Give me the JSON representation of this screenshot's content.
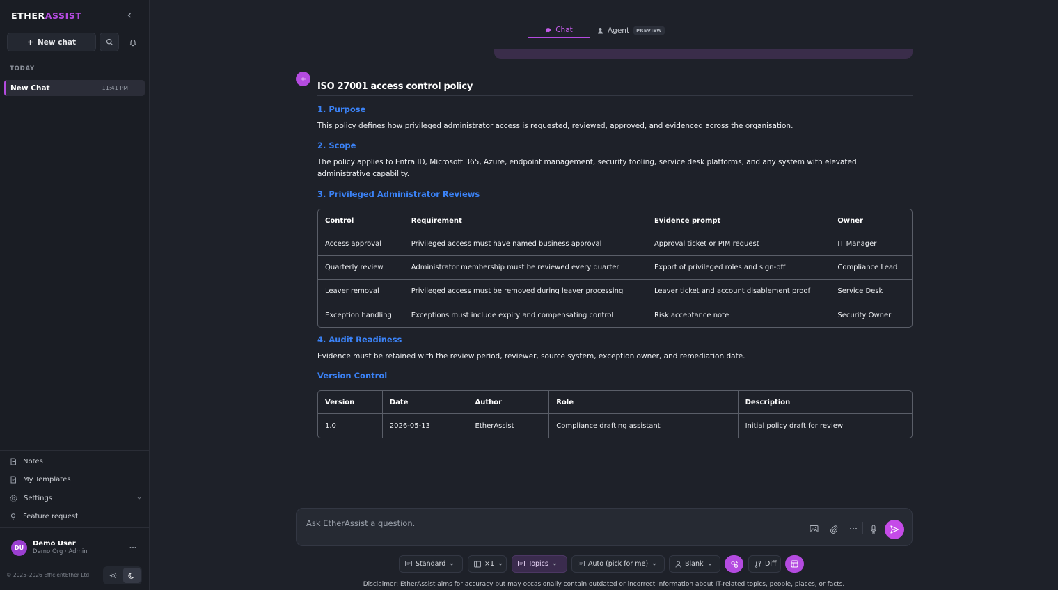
{
  "app": {
    "logo_part1": "ETHER",
    "logo_part2": "ASSIST",
    "accent": "#b44be0",
    "link_color": "#3b82f6"
  },
  "sidebar": {
    "new_chat_label": "New chat",
    "section_label": "TODAY",
    "chats": [
      {
        "title": "New Chat",
        "time": "11:41 PM",
        "active": true
      }
    ],
    "links": [
      {
        "label": "Notes",
        "icon": "notes-icon"
      },
      {
        "label": "My Templates",
        "icon": "template-icon"
      },
      {
        "label": "Settings",
        "icon": "gear-icon",
        "expandable": true
      },
      {
        "label": "Feature request",
        "icon": "lightbulb-icon"
      }
    ],
    "user": {
      "initials": "DU",
      "name": "Demo User",
      "subtitle": "Demo Org · Admin"
    },
    "copyright": "© 2025–2026 EfficientEther Ltd"
  },
  "tabs": {
    "chat": "Chat",
    "agent": "Agent",
    "agent_badge": "PREVIEW"
  },
  "document": {
    "title": "ISO 27001 access control policy",
    "sections": [
      {
        "heading": "1. Purpose",
        "text": "This policy defines how privileged administrator access is requested, reviewed, approved, and evidenced across the organisation."
      },
      {
        "heading": "2. Scope",
        "text": "The policy applies to Entra ID, Microsoft 365, Azure, endpoint management, security tooling, service desk platforms, and any system with elevated administrative capability."
      },
      {
        "heading": "3. Privileged Administrator Reviews",
        "text": ""
      },
      {
        "heading": "4. Audit Readiness",
        "text": "Evidence must be retained with the review period, reviewer, source system, exception owner, and remediation date."
      },
      {
        "heading": "Version Control",
        "text": ""
      }
    ],
    "reviews_table": {
      "headers": [
        "Control",
        "Requirement",
        "Evidence prompt",
        "Owner"
      ],
      "rows": [
        [
          "Access approval",
          "Privileged access must have named business approval",
          "Approval ticket or PIM request",
          "IT Manager"
        ],
        [
          "Quarterly review",
          "Administrator membership must be reviewed every quarter",
          "Export of privileged roles and sign-off",
          "Compliance Lead"
        ],
        [
          "Leaver removal",
          "Privileged access must be removed during leaver processing",
          "Leaver ticket and account disablement proof",
          "Service Desk"
        ],
        [
          "Exception handling",
          "Exceptions must include expiry and compensating control",
          "Risk acceptance note",
          "Security Owner"
        ]
      ]
    },
    "version_table": {
      "headers": [
        "Version",
        "Date",
        "Author",
        "Role",
        "Description"
      ],
      "rows": [
        [
          "1.0",
          "2026-05-13",
          "EtherAssist",
          "Compliance drafting assistant",
          "Initial policy draft for review"
        ]
      ]
    }
  },
  "composer": {
    "placeholder": "Ask EtherAssist a question."
  },
  "toolbar": {
    "mode": "Standard",
    "count": "×1",
    "topics": "Topics",
    "model": "Auto (pick for me)",
    "template": "Blank",
    "diff": "Diff"
  },
  "disclaimer": "Disclaimer: EtherAssist aims for accuracy but may occasionally contain outdated or incorrect information about IT-related topics, people, places, or facts."
}
